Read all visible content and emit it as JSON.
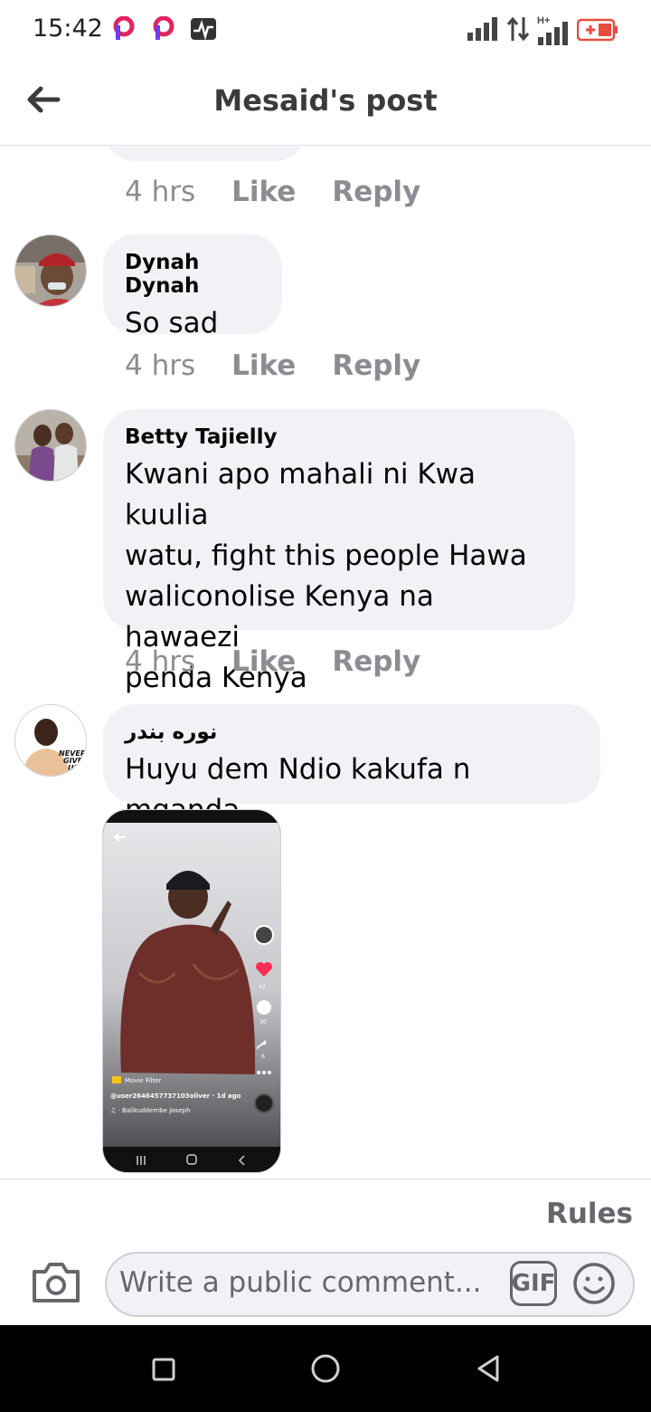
{
  "status_bar": {
    "time": "15:42",
    "icons": [
      "picsart-icon",
      "picsart-icon",
      "activity-icon"
    ],
    "right_icons": [
      "signal-bars-icon",
      "data-transfer-icon",
      "hplus-signal-icon",
      "battery-charging-icon"
    ],
    "hplus_label": "H+"
  },
  "header": {
    "title": "Mesaid's post",
    "back_icon": "arrow-left-icon"
  },
  "comments": [
    {
      "time": "4 hrs",
      "like": "Like",
      "reply": "Reply"
    },
    {
      "author": "Dynah Dynah",
      "text": "So sad",
      "time": "4 hrs",
      "like": "Like",
      "reply": "Reply"
    },
    {
      "author": "Betty Tajielly",
      "text_lines": [
        "Kwani apo mahali ni Kwa kuulia",
        "watu, fight this people Hawa",
        "waliconolise Kenya na hawaezi",
        "penda Kenya"
      ],
      "time": "4 hrs",
      "like": "Like",
      "reply": "Reply"
    },
    {
      "author": "نوره بندر",
      "text": "Huyu dem Ndio kakufa n mganda",
      "avatar_text": [
        "NEVER",
        "GIVE",
        "UP"
      ],
      "attachment": {
        "tag": "Movie Filter",
        "user": "@user2646457737103oliver · 1d ago",
        "music": "♫ · Balikuddembe Joseph",
        "likes": "42",
        "comments": "30",
        "shares": "6"
      }
    }
  ],
  "footer": {
    "rules": "Rules",
    "placeholder": "Write a public comment...",
    "gif_label": "GIF"
  },
  "nav": {
    "icons": [
      "recents-square-icon",
      "home-circle-icon",
      "back-triangle-icon"
    ]
  }
}
